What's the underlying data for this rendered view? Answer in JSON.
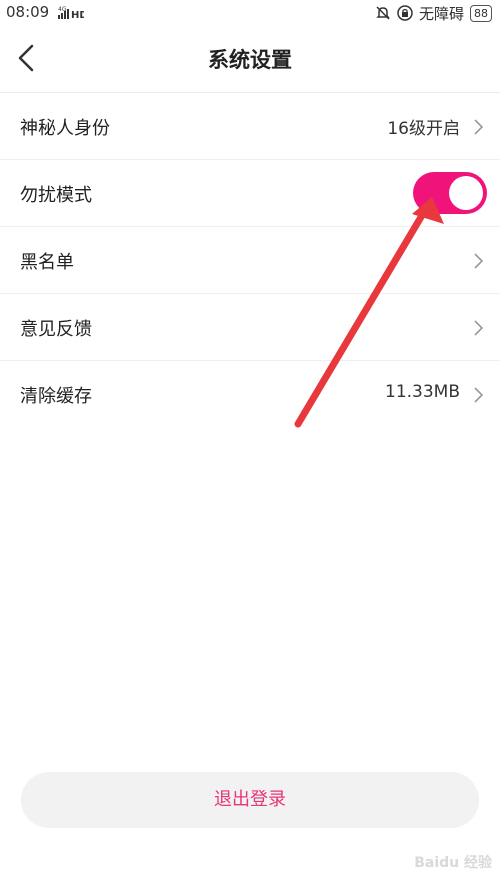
{
  "status_bar": {
    "time": "08:09",
    "network": "4G",
    "hd": "HD",
    "accessibility": "无障碍",
    "battery": "88"
  },
  "header": {
    "title": "系统设置"
  },
  "settings": [
    {
      "label": "神秘人身份",
      "value": "16级开启"
    },
    {
      "label": "勿扰模式",
      "toggle_on": true
    },
    {
      "label": "黑名单"
    },
    {
      "label": "意见反馈"
    },
    {
      "label": "清除缓存",
      "value": "11.33MB"
    }
  ],
  "logout_label": "退出登录",
  "watermark": "Baidu 经验",
  "colors": {
    "accent": "#f0147a",
    "logout_text": "#e8357a",
    "annotation_arrow": "#e8383d"
  }
}
